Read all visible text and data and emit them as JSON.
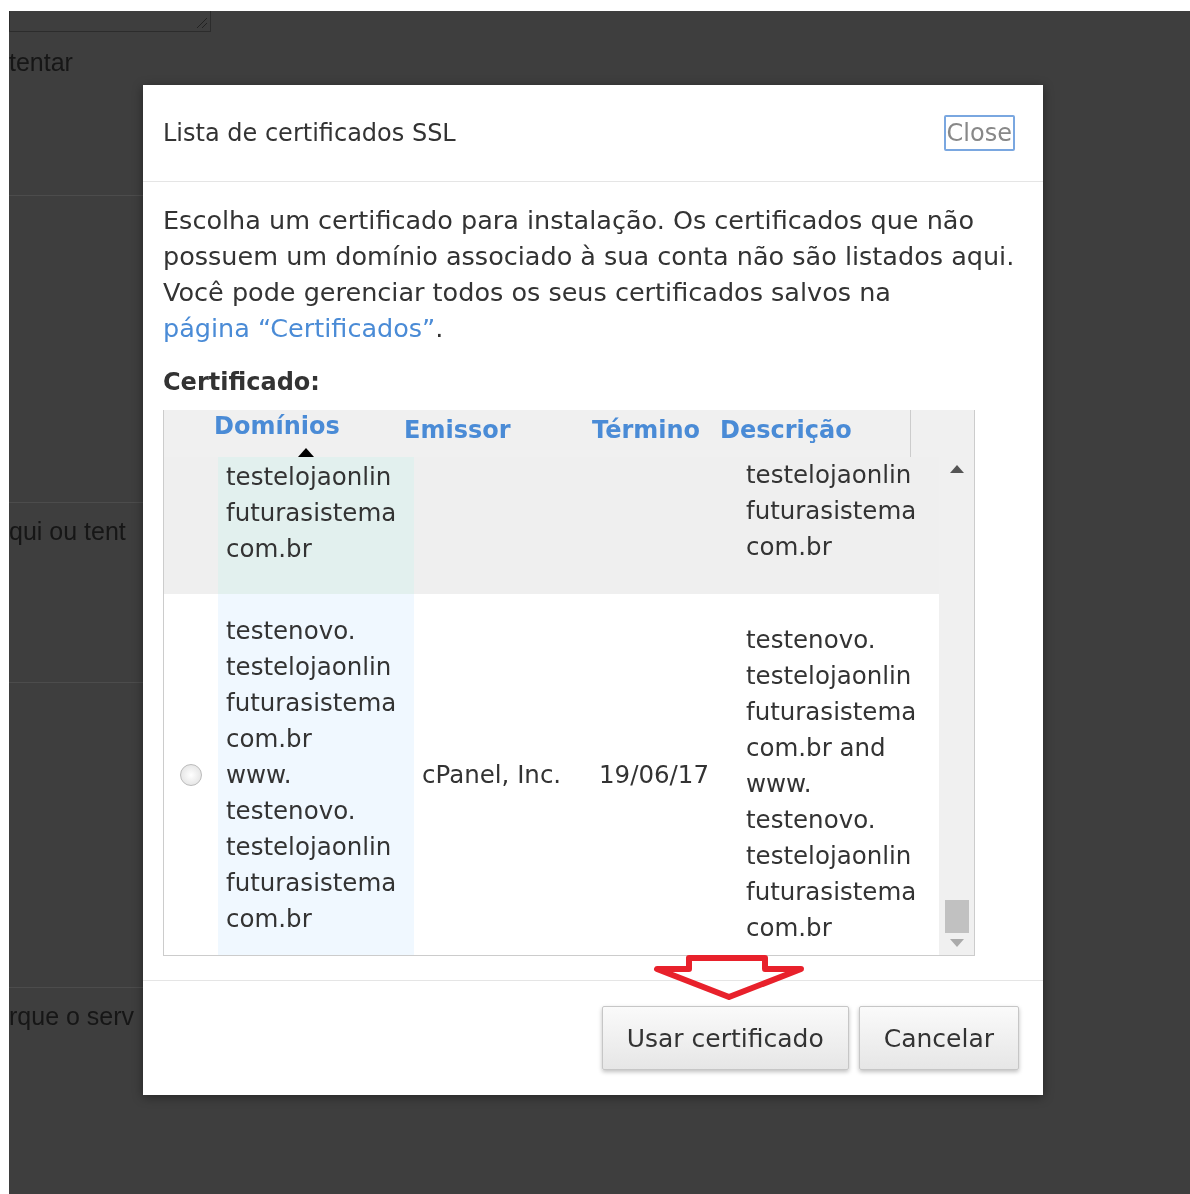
{
  "background_page": {
    "texts": [
      "tentar",
      "qui ou tent",
      "rque o serv"
    ]
  },
  "dialog": {
    "title": "Lista de certificados SSL",
    "close_button": "Close",
    "description": {
      "text": "Escolha um certificado para instalação. Os certificados que não possuem um domínio associado à sua conta não são listados aqui. Você pode gerenciar todos os seus certificados salvos na ",
      "link": "página “Certificados”",
      "text_after": "."
    },
    "field_label": "Certificado:",
    "table": {
      "columns": [
        {
          "label": "Domínios",
          "sorted": true
        },
        {
          "label": "Emissor",
          "sorted": false
        },
        {
          "label": "Término",
          "sorted": false
        },
        {
          "label": "Descrição",
          "sorted": false
        }
      ],
      "rows": [
        {
          "highlighted": true,
          "domains": "testelojaonlin\nfuturasistema\ncom.br",
          "description": "testelojaonlin\nfuturasistema\ncom.br"
        },
        {
          "highlighted": false,
          "radio": {
            "selected": false
          },
          "domains": "testenovo.\ntestelojaonlin\nfuturasistema\ncom.br\nwww.\ntestenovo.\ntestelojaonlin\nfuturasistema\ncom.br",
          "issuer": "cPanel, Inc.",
          "expires": "19/06/17",
          "description": "testenovo.\ntestelojaonlin\nfuturasistema\ncom.br and\nwww.\ntestenovo.\ntestelojaonlin\nfuturasistema\ncom.br"
        }
      ]
    },
    "buttons": [
      {
        "label": "Usar certificado"
      },
      {
        "label": "Cancelar"
      }
    ]
  }
}
